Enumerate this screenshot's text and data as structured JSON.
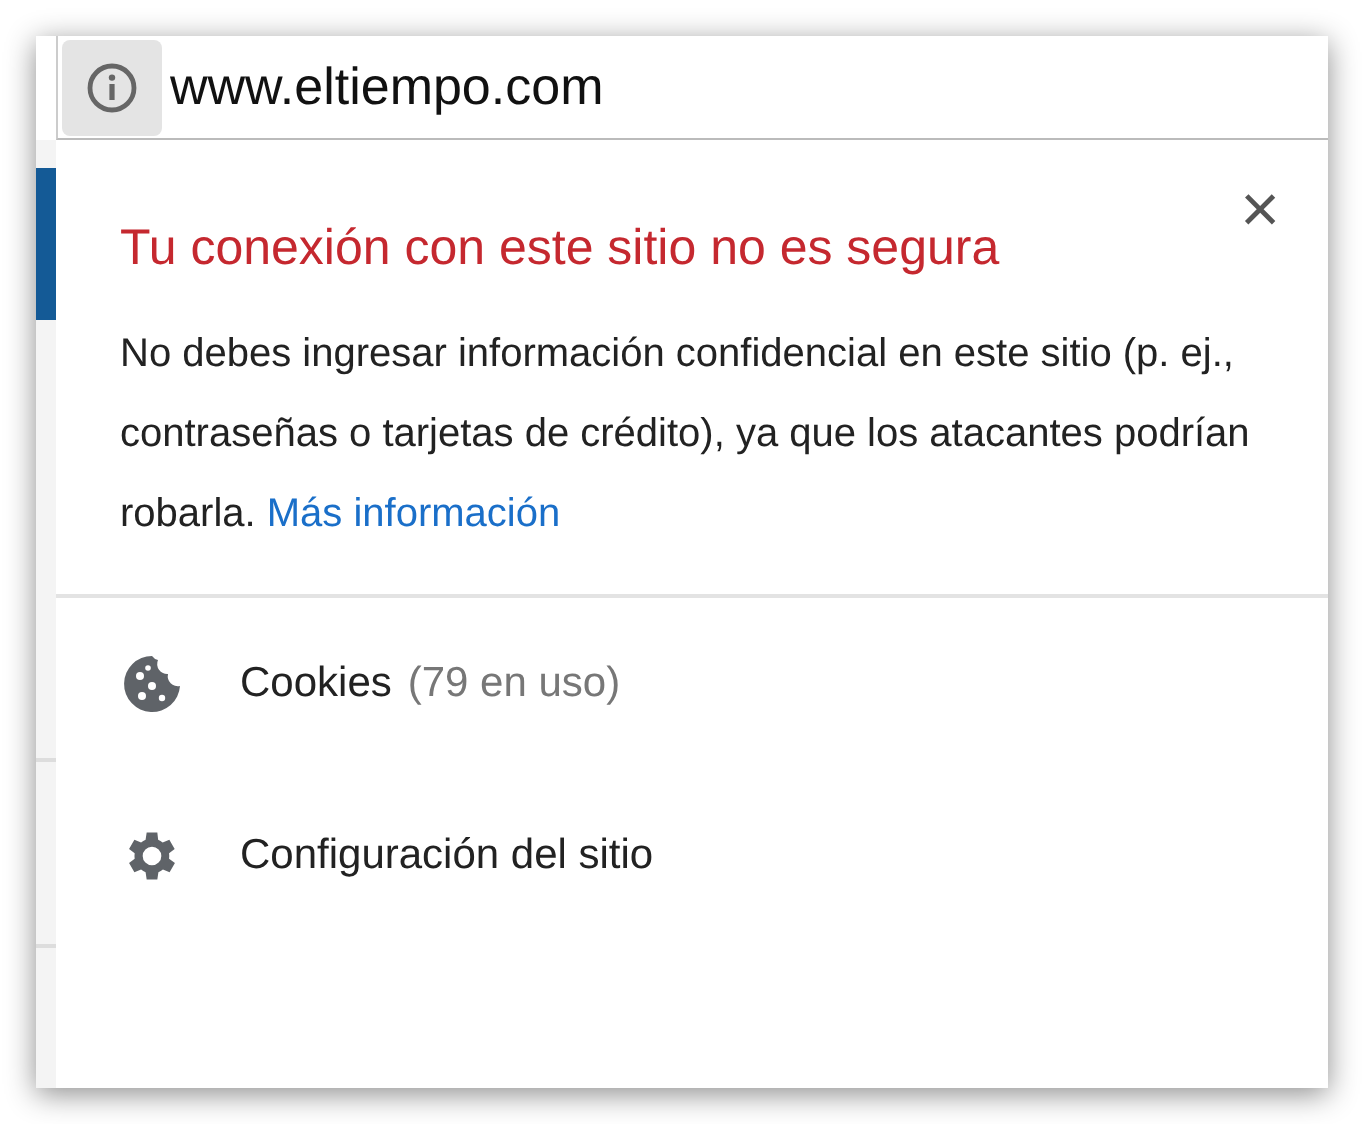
{
  "address_bar": {
    "url": "www.eltiempo.com"
  },
  "popup": {
    "title": "Tu conexión con este sitio no es segura",
    "message": "No debes ingresar información confidencial en este sitio (p. ej., contraseñas o tarjetas de crédito), ya que los atacantes podrían robarla.",
    "link": "Más información",
    "close": "×",
    "items": [
      {
        "kind": "cookies",
        "label": "Cookies",
        "detail": "(79 en uso)"
      },
      {
        "kind": "settings",
        "label": "Configuración del sitio"
      }
    ]
  }
}
